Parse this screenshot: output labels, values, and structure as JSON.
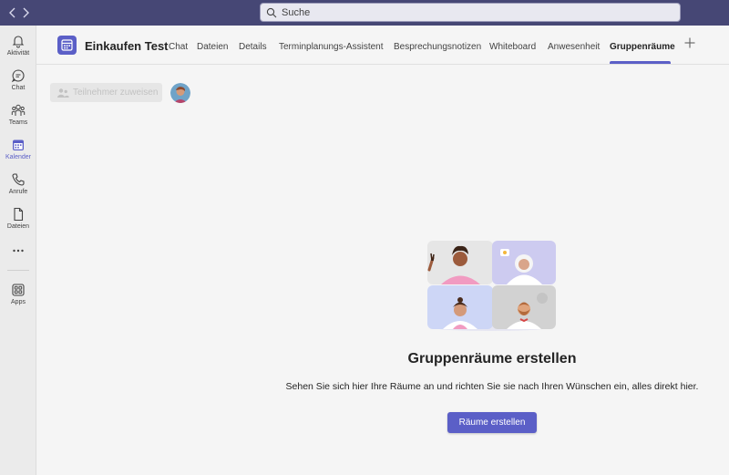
{
  "colors": {
    "accent": "#5b5fc7",
    "titlebar": "#464775"
  },
  "search": {
    "placeholder": "Suche"
  },
  "rail": [
    {
      "label": "Aktivität",
      "icon": "bell-icon"
    },
    {
      "label": "Chat",
      "icon": "chat-icon"
    },
    {
      "label": "Teams",
      "icon": "teams-icon"
    },
    {
      "label": "Kalender",
      "icon": "calendar-icon",
      "active": true
    },
    {
      "label": "Anrufe",
      "icon": "phone-icon"
    },
    {
      "label": "Dateien",
      "icon": "file-icon"
    },
    {
      "label": "Apps",
      "icon": "apps-icon"
    }
  ],
  "meeting": {
    "title": "Einkaufen Test"
  },
  "tabs": [
    {
      "label": "Chat"
    },
    {
      "label": "Dateien"
    },
    {
      "label": "Details"
    },
    {
      "label": "Terminplanungs-Assistent"
    },
    {
      "label": "Besprechungsnotizen"
    },
    {
      "label": "Whiteboard"
    },
    {
      "label": "Anwesenheit"
    },
    {
      "label": "Gruppenräume",
      "active": true
    }
  ],
  "toolbar": {
    "assign_label": "Teilnehmer zuweisen"
  },
  "empty_state": {
    "title": "Gruppenräume erstellen",
    "description": "Sehen Sie sich hier Ihre Räume an und richten Sie sie nach Ihren Wünschen ein, alles direkt hier.",
    "button_label": "Räume erstellen"
  }
}
